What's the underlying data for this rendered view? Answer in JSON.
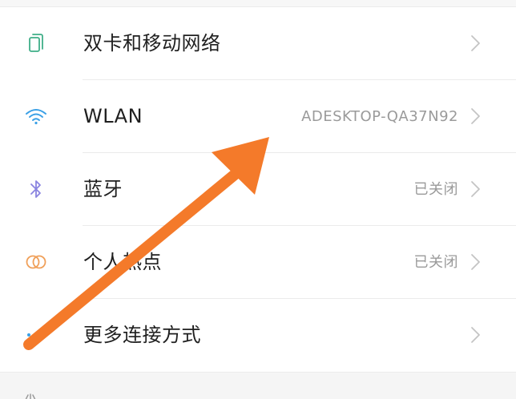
{
  "settings": {
    "rows": [
      {
        "icon": "sim-card-icon",
        "label": "双卡和移动网络",
        "value": ""
      },
      {
        "icon": "wifi-icon",
        "label": "WLAN",
        "value": "ADESKTOP-QA37N92"
      },
      {
        "icon": "bluetooth-icon",
        "label": "蓝牙",
        "value": "已关闭"
      },
      {
        "icon": "hotspot-icon",
        "label": "个人热点",
        "value": "已关闭"
      },
      {
        "icon": "more-dots-icon",
        "label": "更多连接方式",
        "value": ""
      }
    ]
  },
  "colors": {
    "sim_icon": "#3fae88",
    "wifi_icon": "#3ba0e6",
    "bluetooth_icon": "#8a84e0",
    "hotspot_icon": "#f0a05a",
    "more_icon": "#3ba0e6",
    "arrow": "#f47a2a",
    "chevron": "#c4c4c4"
  }
}
